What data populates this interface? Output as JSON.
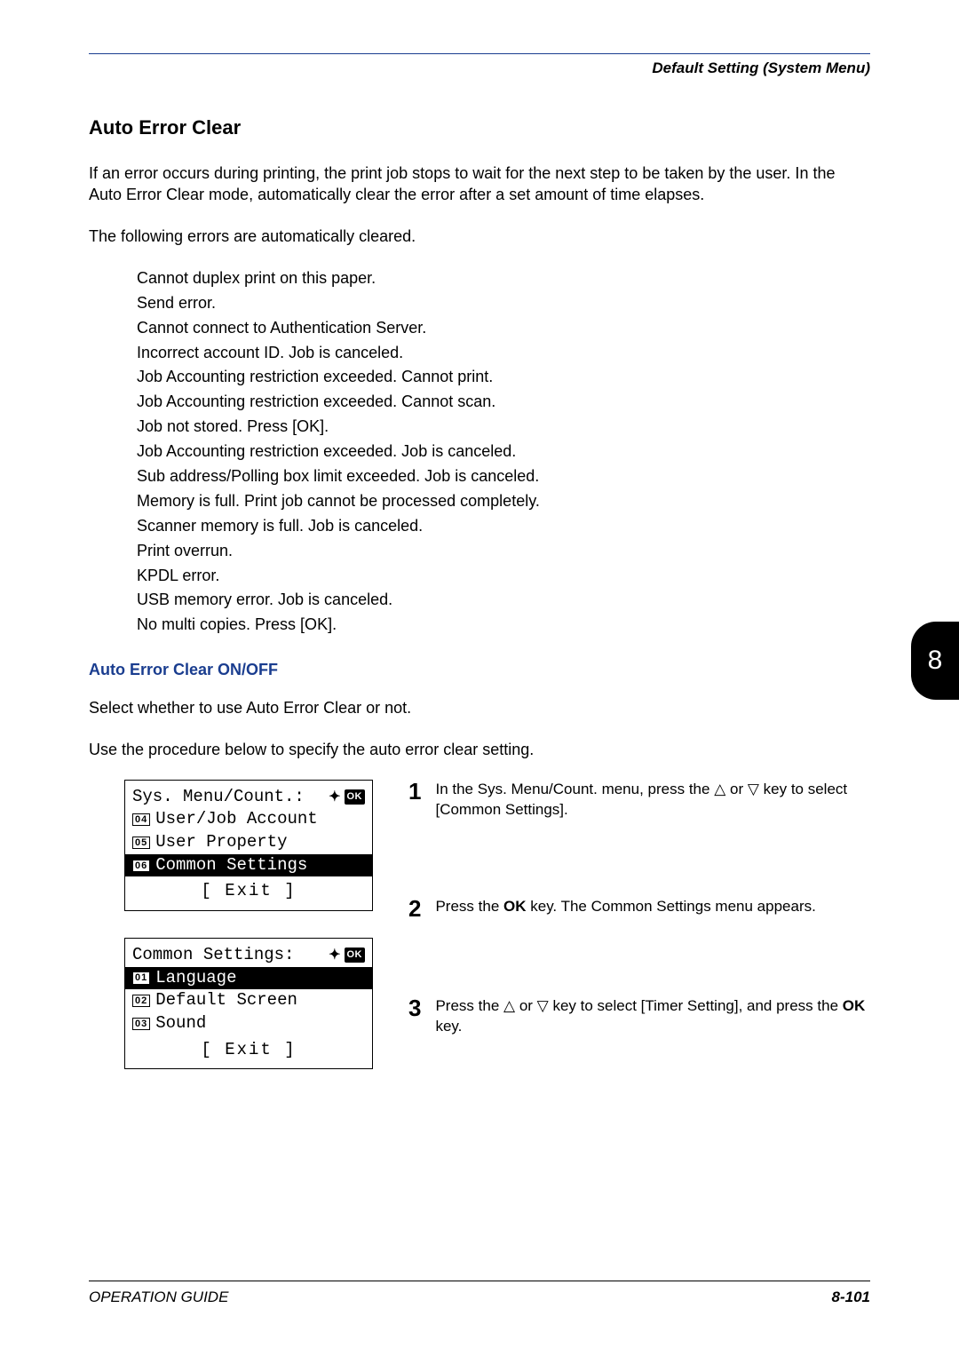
{
  "header": {
    "breadcrumb": "Default Setting (System Menu)"
  },
  "section": {
    "title": "Auto Error Clear",
    "intro": "If an error occurs during printing, the print job stops to wait for the next step to be taken by the user. In the Auto Error Clear mode, automatically clear the error after a set amount of time elapses.",
    "list_intro": "The following errors are automatically cleared.",
    "errors": [
      "Cannot duplex print on this paper.",
      "Send error.",
      "Cannot connect to Authentication Server.",
      "Incorrect account ID. Job is canceled.",
      "Job Accounting restriction exceeded. Cannot print.",
      "Job Accounting restriction exceeded. Cannot scan.",
      "Job not stored. Press [OK].",
      "Job Accounting restriction exceeded. Job is canceled.",
      "Sub address/Polling box limit exceeded. Job is canceled.",
      "Memory is full. Print job cannot be processed completely.",
      "Scanner memory is full. Job is canceled.",
      "Print overrun.",
      "KPDL error.",
      "USB memory error. Job is canceled.",
      "No multi copies. Press [OK]."
    ]
  },
  "subsection": {
    "title": "Auto Error Clear ON/OFF",
    "p1": "Select whether to use Auto Error Clear or not.",
    "p2": "Use the procedure below to specify the auto error clear setting."
  },
  "lcd1": {
    "title": "Sys. Menu/Count.:",
    "ok": "OK",
    "rows": [
      {
        "num": "04",
        "label": "User/Job Account",
        "selected": false
      },
      {
        "num": "05",
        "label": "User Property",
        "selected": false
      },
      {
        "num": "06",
        "label": "Common Settings",
        "selected": true
      }
    ],
    "exit": "[  Exit  ]"
  },
  "lcd2": {
    "title": "Common Settings:",
    "ok": "OK",
    "rows": [
      {
        "num": "01",
        "label": "Language",
        "selected": true
      },
      {
        "num": "02",
        "label": "Default Screen",
        "selected": false
      },
      {
        "num": "03",
        "label": "Sound",
        "selected": false
      }
    ],
    "exit": "[  Exit  ]"
  },
  "steps": {
    "s1": {
      "num": "1",
      "text_a": "In the Sys. Menu/Count. menu, press the ",
      "text_b": " or ",
      "text_c": " key to select [Common Settings]."
    },
    "s2": {
      "num": "2",
      "text_a": "Press the ",
      "ok": "OK",
      "text_b": " key. The Common Settings menu appears."
    },
    "s3": {
      "num": "3",
      "text_a": "Press the ",
      "text_b": " or ",
      "text_c": " key to select [Timer Setting], and press the ",
      "ok": "OK",
      "text_d": " key."
    }
  },
  "tab": {
    "label": "8"
  },
  "footer": {
    "left": "OPERATION GUIDE",
    "right": "8-101"
  }
}
